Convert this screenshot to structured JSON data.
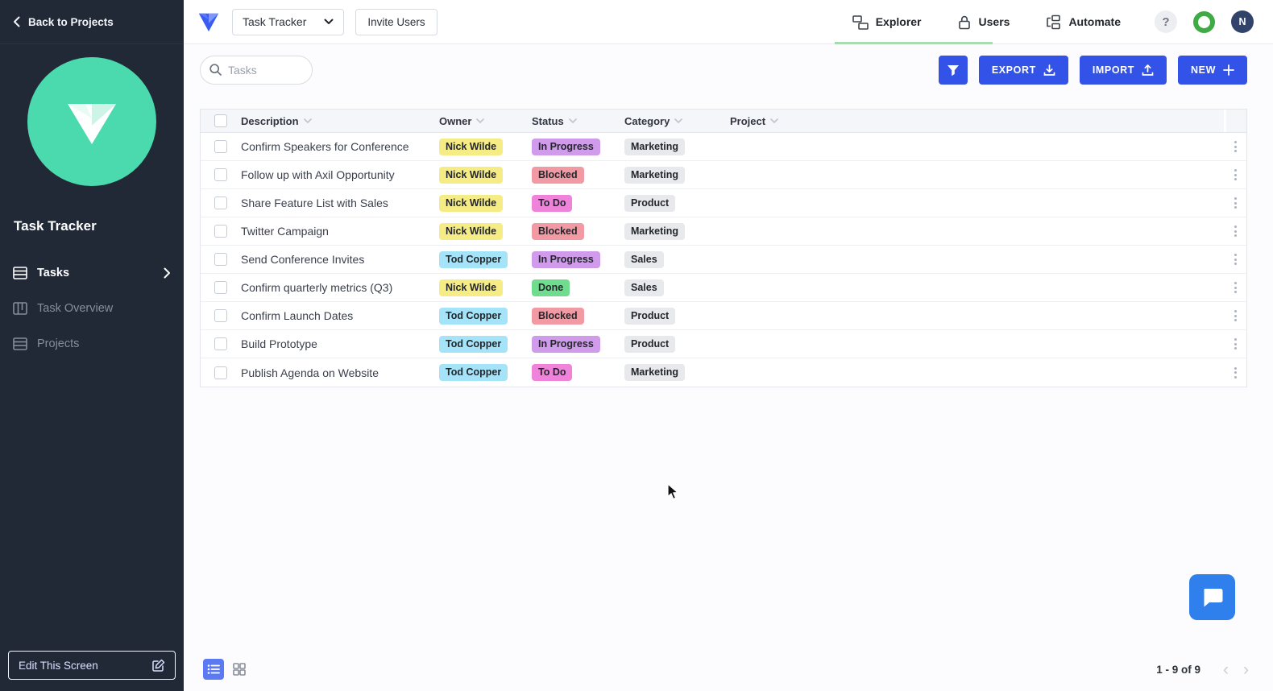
{
  "sidebar": {
    "back_label": "Back to Projects",
    "app_title": "Task Tracker",
    "items": [
      {
        "label": "Tasks",
        "active": true
      },
      {
        "label": "Task Overview",
        "active": false
      },
      {
        "label": "Projects",
        "active": false
      }
    ],
    "edit_button": "Edit This Screen"
  },
  "header": {
    "app_select": "Task Tracker",
    "invite_button": "Invite Users",
    "tabs": [
      {
        "label": "Explorer"
      },
      {
        "label": "Users"
      },
      {
        "label": "Automate"
      }
    ],
    "help_glyph": "?",
    "avatar_initial": "N"
  },
  "toolbar": {
    "search_placeholder": "Tasks",
    "export_label": "EXPORT",
    "import_label": "IMPORT",
    "new_label": "NEW"
  },
  "table": {
    "columns": [
      "Description",
      "Owner",
      "Status",
      "Category",
      "Project"
    ],
    "rows": [
      {
        "description": "Confirm Speakers for Conference",
        "owner": "Nick Wilde",
        "status": "In Progress",
        "category": "Marketing",
        "project": ""
      },
      {
        "description": "Follow up with Axil Opportunity",
        "owner": "Nick Wilde",
        "status": "Blocked",
        "category": "Marketing",
        "project": ""
      },
      {
        "description": "Share Feature List with Sales",
        "owner": "Nick Wilde",
        "status": "To Do",
        "category": "Product",
        "project": ""
      },
      {
        "description": "Twitter Campaign",
        "owner": "Nick Wilde",
        "status": "Blocked",
        "category": "Marketing",
        "project": ""
      },
      {
        "description": "Send Conference Invites",
        "owner": "Tod Copper",
        "status": "In Progress",
        "category": "Sales",
        "project": ""
      },
      {
        "description": "Confirm quarterly metrics (Q3)",
        "owner": "Nick Wilde",
        "status": "Done",
        "category": "Sales",
        "project": ""
      },
      {
        "description": "Confirm Launch Dates",
        "owner": "Tod Copper",
        "status": "Blocked",
        "category": "Product",
        "project": ""
      },
      {
        "description": "Build Prototype",
        "owner": "Tod Copper",
        "status": "In Progress",
        "category": "Product",
        "project": ""
      },
      {
        "description": "Publish Agenda on Website",
        "owner": "Tod Copper",
        "status": "To Do",
        "category": "Marketing",
        "project": ""
      }
    ]
  },
  "footer": {
    "range": "1 - 9 of 9",
    "prev_glyph": "‹",
    "next_glyph": "›"
  },
  "icons": {
    "back": "chevron-left",
    "app_select_caret": "chevron-down",
    "search": "magnifier",
    "filter": "funnel",
    "export": "download-arrow",
    "import": "upload-arrow",
    "new": "plus",
    "sort": "chevron-down",
    "row_menu": "kebab-vertical",
    "chat": "speech-bubble",
    "edit": "pencil-square",
    "view_list": "list-rows",
    "view_grid": "grid-squares",
    "explorer_tab": "cascade-windows",
    "users_tab": "padlock",
    "automate_tab": "flow-nodes"
  },
  "colors": {
    "primary": "#3353e8",
    "sidebar_bg": "#212836",
    "logo_teal": "#4bd9ae",
    "tab_underline": "#a9dbb1",
    "chat_fab": "#2f80ec",
    "owner_badges": {
      "Nick Wilde": "#f6ec86",
      "Tod Copper": "#a5e4f8"
    },
    "status_badges": {
      "In Progress": "#cf9bea",
      "Blocked": "#f29aa4",
      "To Do": "#ef83da",
      "Done": "#6fdd8d"
    },
    "category_badge": "#e8e9ec"
  }
}
